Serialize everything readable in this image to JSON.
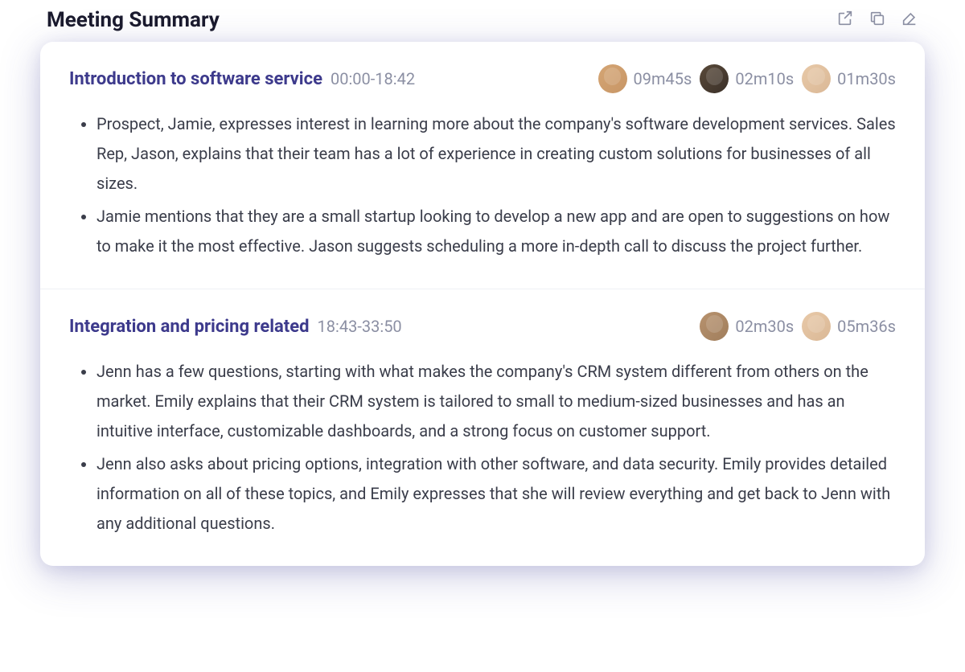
{
  "header": {
    "title": "Meeting Summary"
  },
  "sections": [
    {
      "title": "Introduction to software service",
      "time_range": "00:00-18:42",
      "participants": [
        {
          "avatar_class": "av1",
          "duration": "09m45s"
        },
        {
          "avatar_class": "av2",
          "duration": "02m10s"
        },
        {
          "avatar_class": "av3",
          "duration": "01m30s"
        }
      ],
      "bullets": [
        "Prospect, Jamie, expresses interest in learning more about the company's software development services. Sales Rep, Jason, explains that their team has a lot of experience in creating custom solutions for businesses of all sizes.",
        "Jamie mentions that they are a small startup looking to develop a new app and are open to suggestions on how to make it the most effective. Jason suggests scheduling a more in-depth call to discuss the project further."
      ]
    },
    {
      "title": "Integration and pricing related",
      "time_range": "18:43-33:50",
      "participants": [
        {
          "avatar_class": "av4",
          "duration": "02m30s"
        },
        {
          "avatar_class": "av3",
          "duration": "05m36s"
        }
      ],
      "bullets": [
        "Jenn has a few questions, starting with what makes the company's CRM system different from others on the market. Emily explains that their CRM system is tailored to small to medium-sized businesses and has an intuitive interface, customizable dashboards, and a strong focus on customer support.",
        "Jenn also asks about pricing options, integration with other software, and data security. Emily provides detailed information on all of these topics, and Emily expresses that she will review everything and get back to Jenn with any additional questions."
      ]
    }
  ]
}
